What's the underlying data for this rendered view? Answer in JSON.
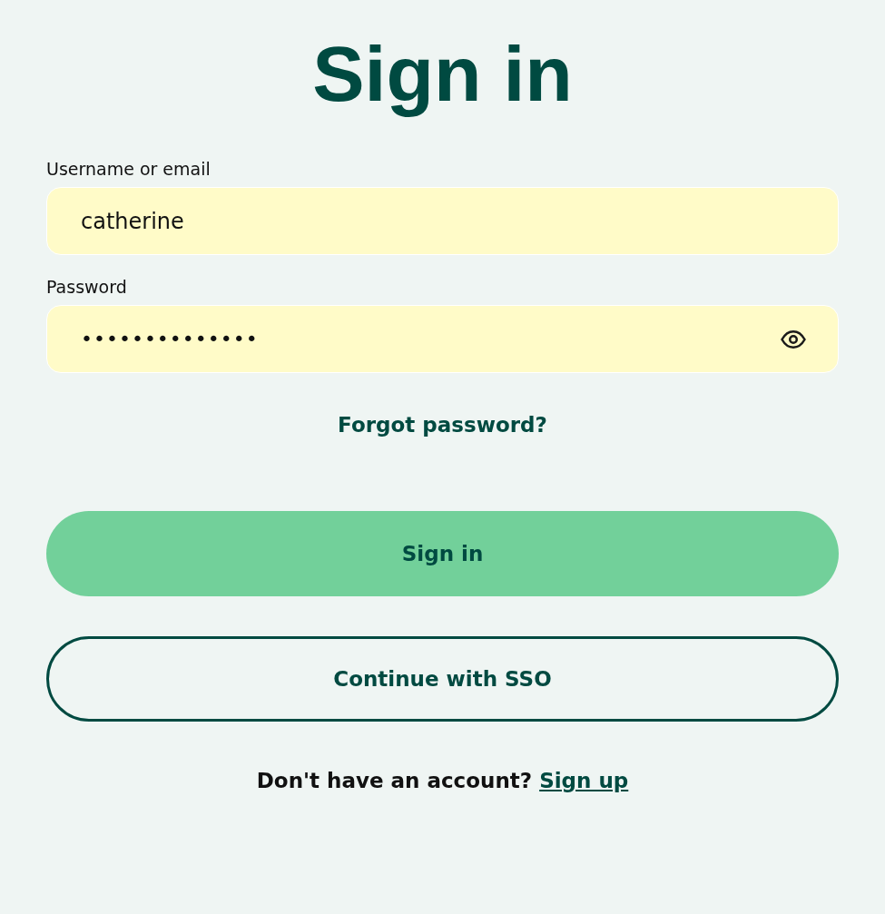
{
  "title": "Sign in",
  "fields": [
    {
      "label": "Username or email",
      "value": "catherine",
      "kind": "text"
    },
    {
      "label": "Password",
      "value": "••••••••••••••",
      "kind": "password"
    }
  ],
  "forgot_link": "Forgot password?",
  "buttons": [
    {
      "label": "Sign in",
      "kind": "primary"
    },
    {
      "label": "Continue with SSO",
      "kind": "outline"
    }
  ],
  "footer": {
    "text": "Don't have an account?",
    "link": "Sign up"
  }
}
